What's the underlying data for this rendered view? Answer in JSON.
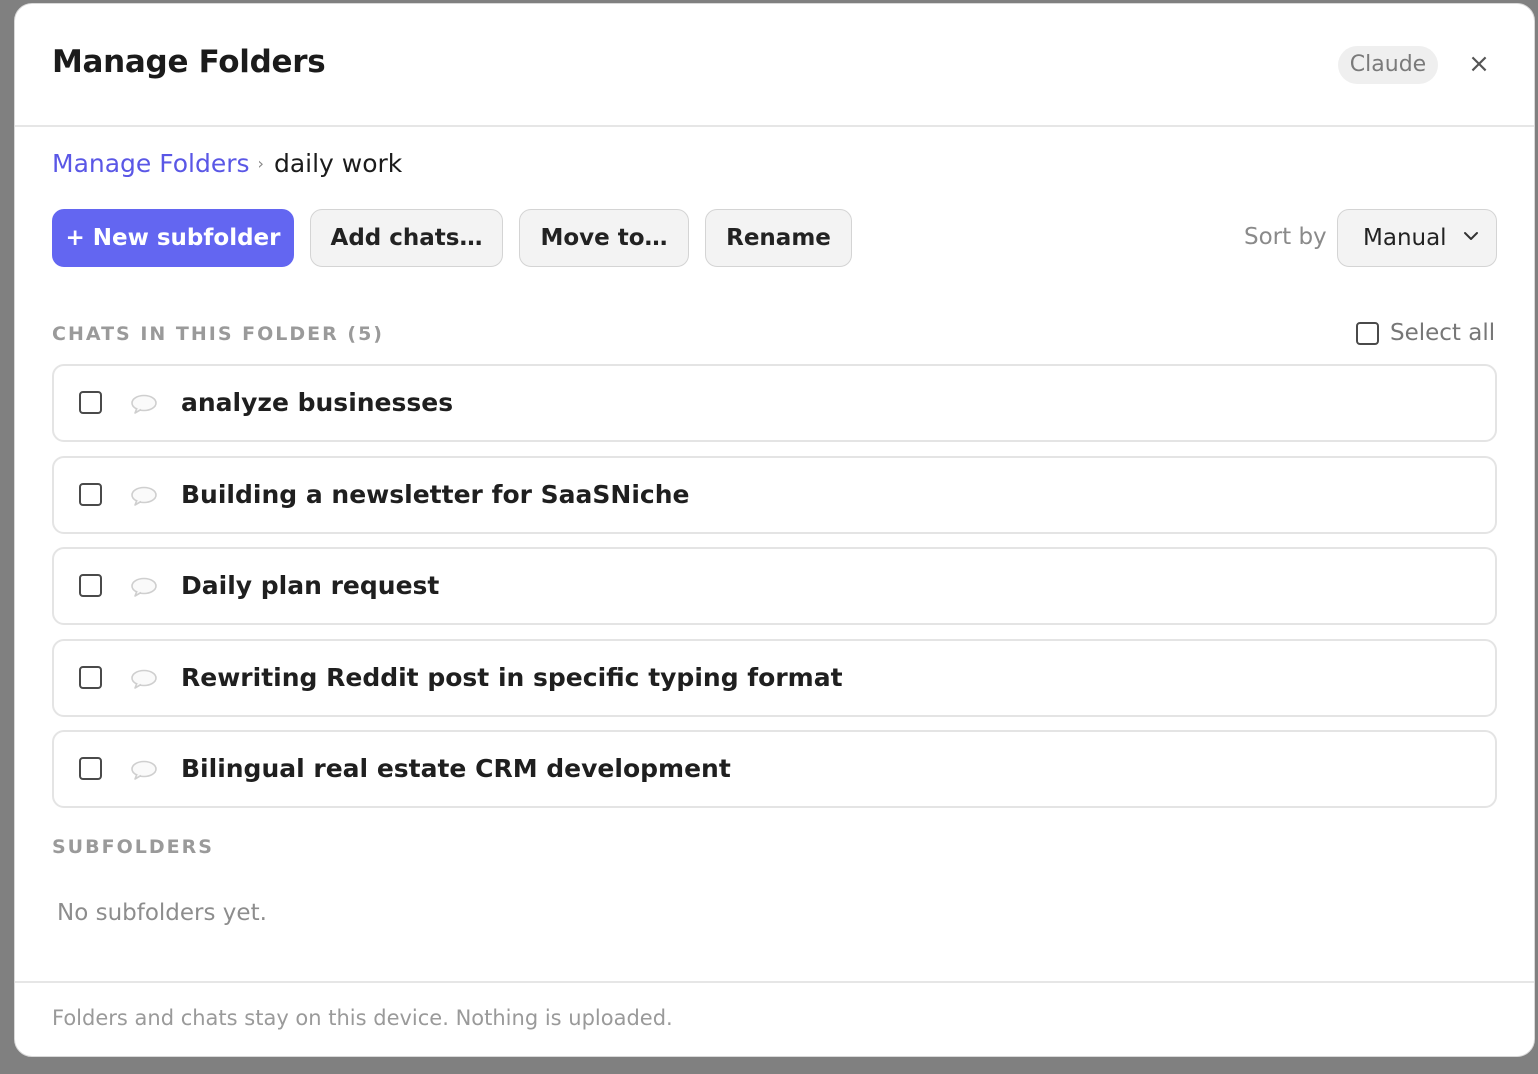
{
  "dialog": {
    "title": "Manage Folders",
    "badge": "Claude",
    "close_symbol": "×"
  },
  "breadcrumb": {
    "root": "Manage Folders",
    "separator": "›",
    "current": "daily work"
  },
  "toolbar": {
    "new_subfolder_label": "+ New subfolder",
    "add_chats_label": "Add chats…",
    "move_to_label": "Move to…",
    "rename_label": "Rename",
    "sort_by_label": "Sort by",
    "sort_value": "Manual"
  },
  "chats_section": {
    "label": "CHATS IN THIS FOLDER (5)",
    "select_all_label": "Select all",
    "items": [
      {
        "title": "analyze businesses",
        "checked": false
      },
      {
        "title": "Building a newsletter for SaaSNiche",
        "checked": false
      },
      {
        "title": "Daily plan request",
        "checked": false
      },
      {
        "title": "Rewriting Reddit post in specific typing format",
        "checked": false
      },
      {
        "title": "Bilingual real estate CRM development",
        "checked": false
      }
    ]
  },
  "subfolders_section": {
    "label": "SUBFOLDERS",
    "empty_text": "No subfolders yet."
  },
  "footer": {
    "text": "Folders and chats stay on this device. Nothing is uploaded."
  },
  "colors": {
    "accent": "#6366f1",
    "link": "#5a57e6"
  },
  "icons": {
    "chat_item": "speech-bubble-icon",
    "sort_dropdown": "chevron-down-icon",
    "close": "close-icon"
  }
}
